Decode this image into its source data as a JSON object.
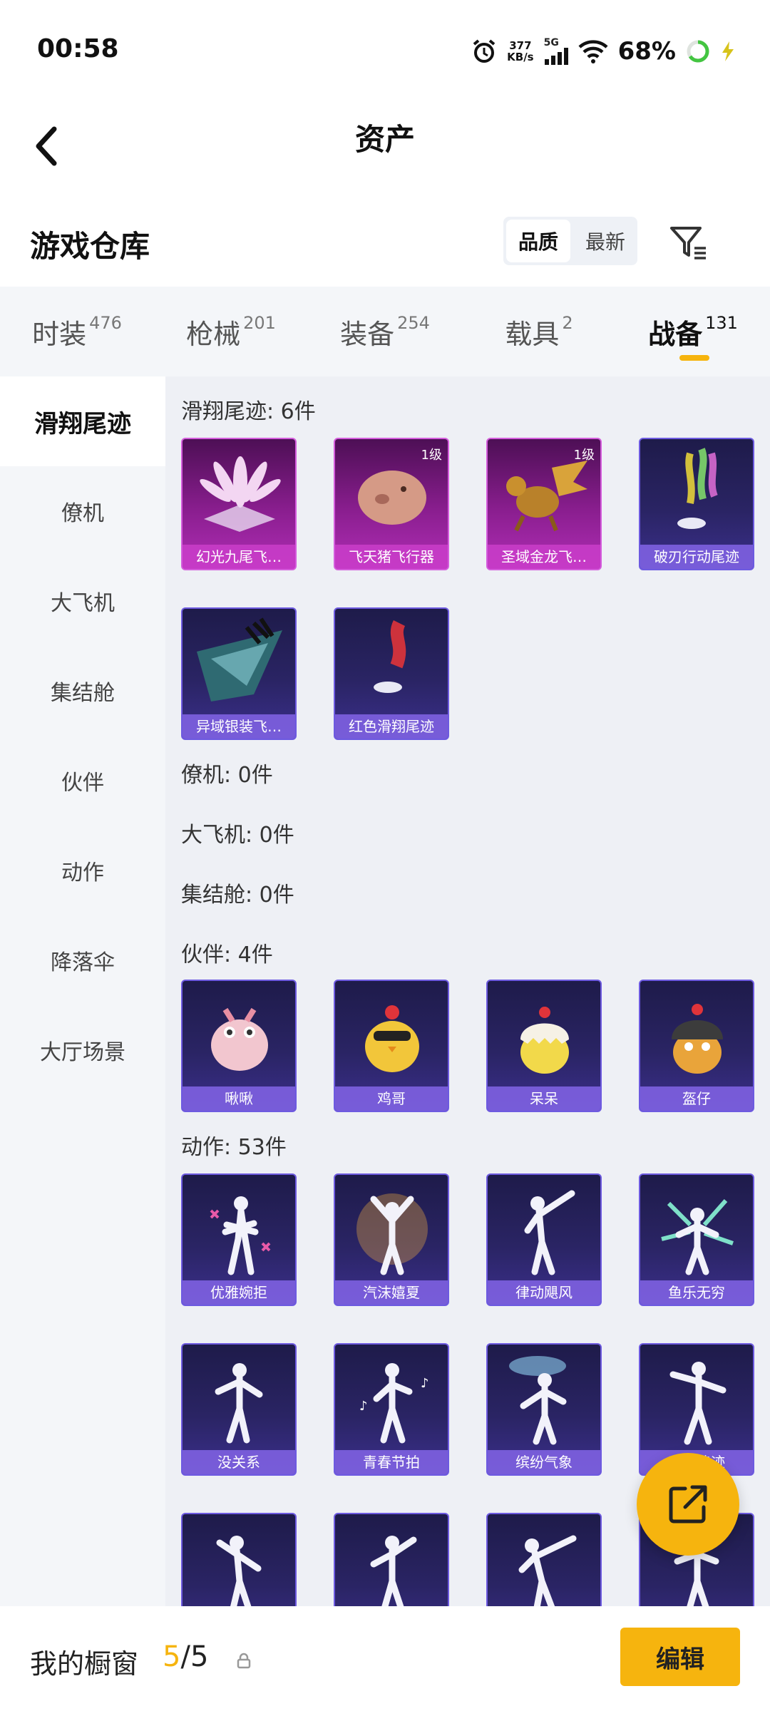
{
  "status_bar": {
    "time": "00:58",
    "net_speed_value": "377",
    "net_speed_unit": "KB/s",
    "network": "5G",
    "battery": "68%",
    "icons": [
      "alarm-icon",
      "signal-icon",
      "wifi-icon",
      "battery-icon",
      "charging-icon"
    ]
  },
  "header": {
    "title": "资产",
    "back_icon": "chevron-left-icon"
  },
  "warehouse": {
    "label": "游戏仓库",
    "sort_options": [
      "品质",
      "最新"
    ],
    "sort_selected": "品质",
    "filter_icon": "filter-icon"
  },
  "tabs": [
    {
      "label": "时装",
      "count": "476"
    },
    {
      "label": "枪械",
      "count": "201"
    },
    {
      "label": "装备",
      "count": "254"
    },
    {
      "label": "载具",
      "count": "2"
    },
    {
      "label": "战备",
      "count": "131",
      "active": true
    }
  ],
  "side_nav": [
    "滑翔尾迹",
    "僚机",
    "大飞机",
    "集结舱",
    "伙伴",
    "动作",
    "降落伞",
    "大厅场景"
  ],
  "sections": {
    "glide": {
      "title": "滑翔尾迹: 6件",
      "items": [
        {
          "name": "幻光九尾飞…"
        },
        {
          "name": "飞天猪飞行器",
          "level": "1级"
        },
        {
          "name": "圣域金龙飞…",
          "level": "1级"
        },
        {
          "name": "破刃行动尾迹"
        },
        {
          "name": "异域银装飞…"
        },
        {
          "name": "红色滑翔尾迹"
        }
      ]
    },
    "wingman": {
      "title": "僚机: 0件"
    },
    "plane": {
      "title": "大飞机: 0件"
    },
    "pod": {
      "title": "集结舱: 0件"
    },
    "partner": {
      "title": "伙伴: 4件",
      "items": [
        {
          "name": "啾啾"
        },
        {
          "name": "鸡哥"
        },
        {
          "name": "呆呆"
        },
        {
          "name": "盔仔"
        }
      ]
    },
    "emote": {
      "title": "动作: 53件",
      "items": [
        {
          "name": "优雅婉拒"
        },
        {
          "name": "汽沫嬉夏"
        },
        {
          "name": "律动飓风"
        },
        {
          "name": "鱼乐无穷"
        },
        {
          "name": "没关系"
        },
        {
          "name": "青春节拍"
        },
        {
          "name": "缤纷气象"
        },
        {
          "name": "青春律迹"
        },
        {
          "name": ""
        },
        {
          "name": ""
        },
        {
          "name": ""
        },
        {
          "name": ""
        }
      ]
    }
  },
  "fab": {
    "icon": "share-external-icon"
  },
  "bottom_bar": {
    "label": "我的橱窗",
    "current": "5",
    "separator": "/",
    "total": "5",
    "lock_icon": "lock-icon",
    "edit_label": "编辑"
  },
  "colors": {
    "accent": "#f6b40e",
    "card_purple": "#2a2464",
    "card_magenta": "#8a1e8f"
  }
}
